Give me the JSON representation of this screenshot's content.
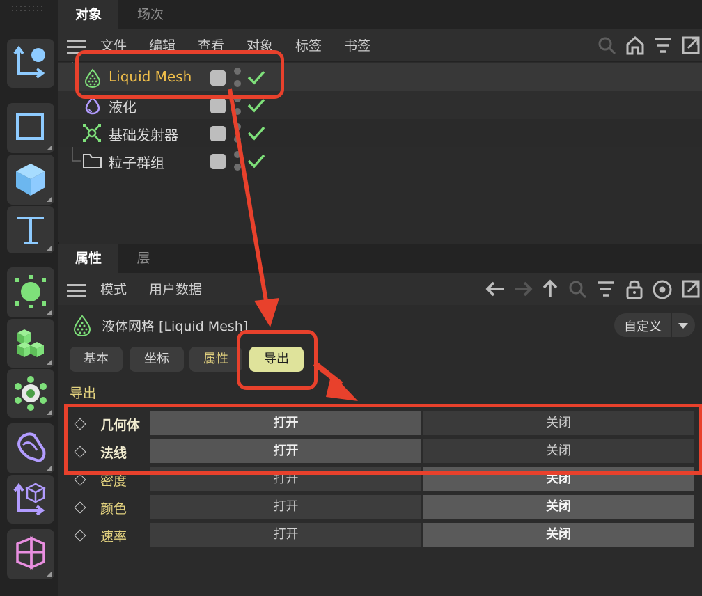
{
  "object_manager": {
    "tabs": [
      "对象",
      "场次"
    ],
    "menu": [
      "文件",
      "编辑",
      "查看",
      "对象",
      "标签",
      "书签"
    ],
    "tree": [
      {
        "label": "Liquid Mesh",
        "icon": "liquid-mesh-icon",
        "selected": true
      },
      {
        "label": "液化",
        "icon": "liquefy-icon"
      },
      {
        "label": "基础发射器",
        "icon": "emitter-icon"
      },
      {
        "label": "粒子群组",
        "icon": "folder-icon"
      }
    ]
  },
  "attribute_manager": {
    "tabs": [
      "属性",
      "层"
    ],
    "menu": [
      "模式",
      "用户数据"
    ],
    "object_title": "液体网格 [Liquid Mesh]",
    "preset_button": "自定义",
    "pill_tabs": [
      "基本",
      "坐标",
      "属性",
      "导出"
    ],
    "active_pill": "导出",
    "section_title": "导出",
    "rows": [
      {
        "label": "几何体",
        "open": "打开",
        "close": "关闭",
        "state": "open"
      },
      {
        "label": "法线",
        "open": "打开",
        "close": "关闭",
        "state": "open"
      },
      {
        "label": "密度",
        "open": "打开",
        "close": "关闭",
        "state": "close"
      },
      {
        "label": "颜色",
        "open": "打开",
        "close": "关闭",
        "state": "close"
      },
      {
        "label": "速率",
        "open": "打开",
        "close": "关闭",
        "state": "close"
      }
    ]
  },
  "colors": {
    "accent_yellow": "#e3d27f",
    "active_pill": "#dfe39b",
    "annotation_red": "#e8412c",
    "check_green": "#7ee07a"
  }
}
